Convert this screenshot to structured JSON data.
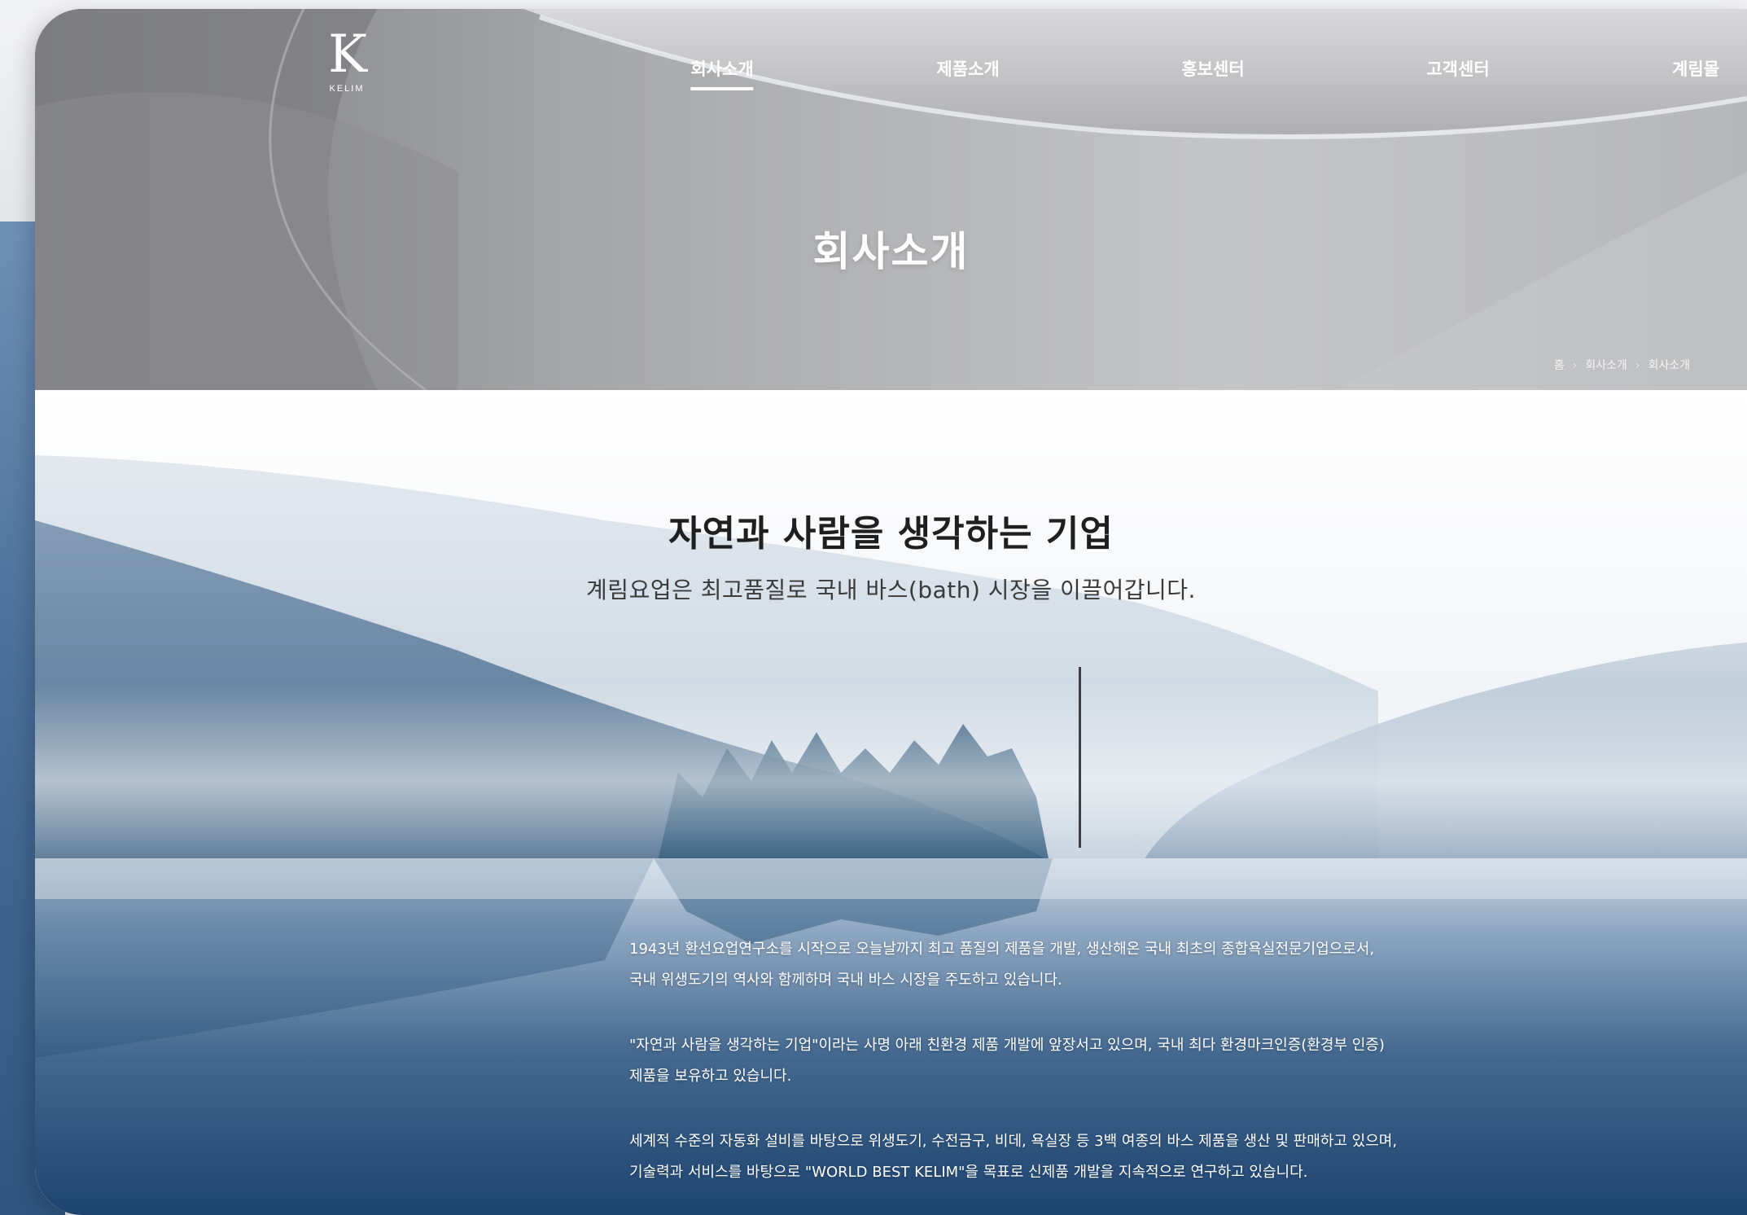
{
  "logo": {
    "mark": "K",
    "text": "KELIM"
  },
  "nav": {
    "items": [
      {
        "label": "회사소개",
        "active": true
      },
      {
        "label": "제품소개",
        "active": false
      },
      {
        "label": "홍보센터",
        "active": false
      },
      {
        "label": "고객센터",
        "active": false
      },
      {
        "label": "계림몰",
        "active": false
      }
    ]
  },
  "hero": {
    "title": "회사소개",
    "breadcrumb": [
      "홈",
      "회사소개",
      "회사소개"
    ],
    "breadcrumb_separator": "›"
  },
  "intro": {
    "headline": "자연과 사람을 생각하는 기업",
    "subline": "계림요업은 최고품질로 국내 바스(bath) 시장을 이끌어갑니다.",
    "paragraphs": [
      [
        "1943년 환선요업연구소를 시작으로 오늘날까지 최고 품질의 제품을 개발, 생산해온 국내 최초의 종합욕실전문기업으로서,",
        "국내 위생도기의 역사와 함께하며 국내 바스 시장을 주도하고 있습니다."
      ],
      [
        "\"자연과 사람을 생각하는 기업\"이라는 사명 아래 친환경 제품 개발에 앞장서고 있으며, 국내 최다 환경마크인증(환경부 인증)",
        "제품을 보유하고 있습니다."
      ],
      [
        "세계적 수준의 자동화 설비를 바탕으로 위생도기, 수전금구, 비데, 욕실장 등 3백 여종의 바스 제품을 생산 및 판매하고 있으며,",
        "기술력과 서비스를 바탕으로 \"WORLD BEST KELIM\"을 목표로 신제품 개발을 지속적으로 연구하고 있습니다."
      ]
    ]
  },
  "colors": {
    "hero_gray": "#9a9b9d",
    "lake_blue": "#1f4a78",
    "text_dark": "#1f1f1f"
  }
}
